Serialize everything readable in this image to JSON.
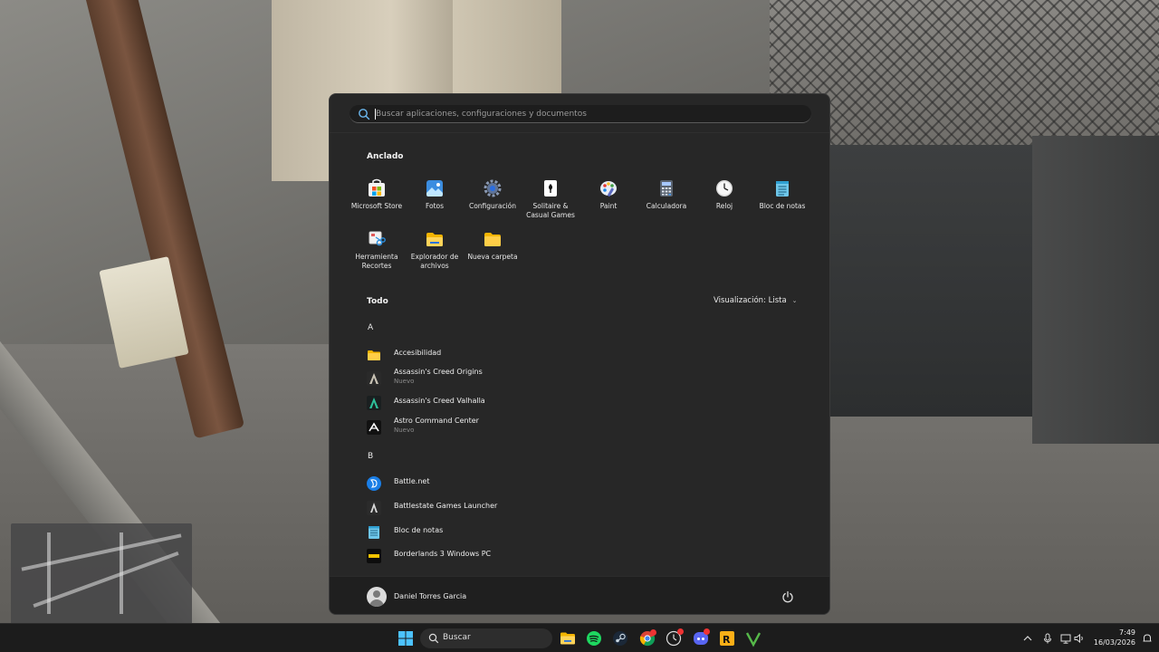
{
  "start_menu": {
    "search": {
      "placeholder": "Buscar aplicaciones, configuraciones y documentos",
      "value": ""
    },
    "pinned": {
      "title": "Anclado",
      "apps": [
        {
          "label": "Microsoft Store",
          "icon": "store-icon"
        },
        {
          "label": "Fotos",
          "icon": "photos-icon"
        },
        {
          "label": "Configuración",
          "icon": "settings-gear-icon"
        },
        {
          "label": "Solitaire & Casual Games",
          "icon": "solitaire-icon"
        },
        {
          "label": "Paint",
          "icon": "paint-palette-icon"
        },
        {
          "label": "Calculadora",
          "icon": "calculator-icon"
        },
        {
          "label": "Reloj",
          "icon": "clock-icon"
        },
        {
          "label": "Bloc de notas",
          "icon": "notepad-icon"
        },
        {
          "label": "Herramienta Recortes",
          "icon": "snipping-tool-icon"
        },
        {
          "label": "Explorador de archivos",
          "icon": "file-explorer-icon"
        },
        {
          "label": "Nueva carpeta",
          "icon": "folder-icon"
        }
      ]
    },
    "all": {
      "title": "Todo",
      "view_label": "Visualización: Lista",
      "groups": [
        {
          "letter": "A",
          "apps": [
            {
              "name": "Accesibilidad",
              "sub": "",
              "icon": "folder-icon"
            },
            {
              "name": "Assassin's Creed Origins",
              "sub": "Nuevo",
              "icon": "ac-origins-icon"
            },
            {
              "name": "Assassin's Creed Valhalla",
              "sub": "",
              "icon": "ac-valhalla-icon"
            },
            {
              "name": "Astro Command Center",
              "sub": "Nuevo",
              "icon": "astro-icon"
            }
          ]
        },
        {
          "letter": "B",
          "apps": [
            {
              "name": "Battle.net",
              "sub": "",
              "icon": "battlenet-icon"
            },
            {
              "name": "Battlestate Games Launcher",
              "sub": "",
              "icon": "battlestate-icon"
            },
            {
              "name": "Bloc de notas",
              "sub": "",
              "icon": "notepad-icon"
            },
            {
              "name": "Borderlands 3 Windows PC",
              "sub": "",
              "icon": "borderlands-icon"
            }
          ]
        }
      ]
    },
    "user": {
      "name": "Daniel Torres Garcia"
    }
  },
  "taskbar": {
    "search_label": "Buscar",
    "apps": [
      "start-icon",
      "file-explorer-icon",
      "spotify-icon",
      "steam-icon",
      "chrome-icon",
      "clock-app-icon",
      "discord-icon",
      "rockstar-icon",
      "gta-v-icon"
    ],
    "clock": {
      "time": "7:49",
      "date": "16/03/2026"
    }
  }
}
